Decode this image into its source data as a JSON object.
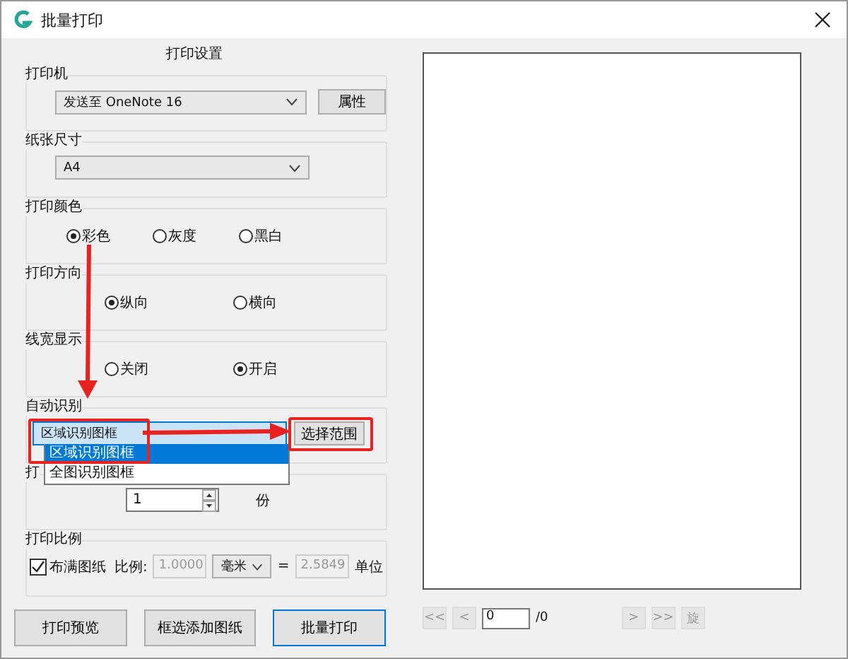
{
  "window": {
    "title": "批量打印"
  },
  "settings_heading": "打印设置",
  "printer": {
    "label": "打印机",
    "value": "发送至 OneNote 16",
    "button": "属性"
  },
  "paper": {
    "label": "纸张尺寸",
    "value": "A4"
  },
  "color": {
    "label": "打印颜色",
    "options": [
      {
        "label": "彩色",
        "selected": true
      },
      {
        "label": "灰度",
        "selected": false
      },
      {
        "label": "黑白",
        "selected": false
      }
    ]
  },
  "orientation": {
    "label": "打印方向",
    "options": [
      {
        "label": "纵向",
        "selected": true
      },
      {
        "label": "横向",
        "selected": false
      }
    ]
  },
  "line_width": {
    "label": "线宽显示",
    "options": [
      {
        "label": "关闭",
        "selected": false
      },
      {
        "label": "开启",
        "selected": true
      }
    ]
  },
  "auto_detect": {
    "label": "自动识别",
    "value": "区域识别图框",
    "button": "选择范围",
    "dropdown_items": [
      {
        "label": "区域识别图框",
        "selected": true
      },
      {
        "label": "全图识别图框",
        "selected": false
      }
    ]
  },
  "copies": {
    "label": "打",
    "value": "1",
    "unit": "份"
  },
  "scale": {
    "label": "打印比例",
    "fill_paper": {
      "label": "布满图纸",
      "checked": true
    },
    "ratio_label": "比例:",
    "ratio": "1.0000",
    "unit": "毫米",
    "equals": "=",
    "result": "2.5849",
    "result_unit": "单位"
  },
  "buttons": [
    {
      "label": "打印预览",
      "default": false
    },
    {
      "label": "框选添加图纸",
      "default": false
    },
    {
      "label": "批量打印",
      "default": true
    }
  ],
  "pager": {
    "first": "<<",
    "prev": "<",
    "page": "0",
    "total": "/0",
    "next": ">",
    "last": ">>",
    "rotate": "旋"
  }
}
